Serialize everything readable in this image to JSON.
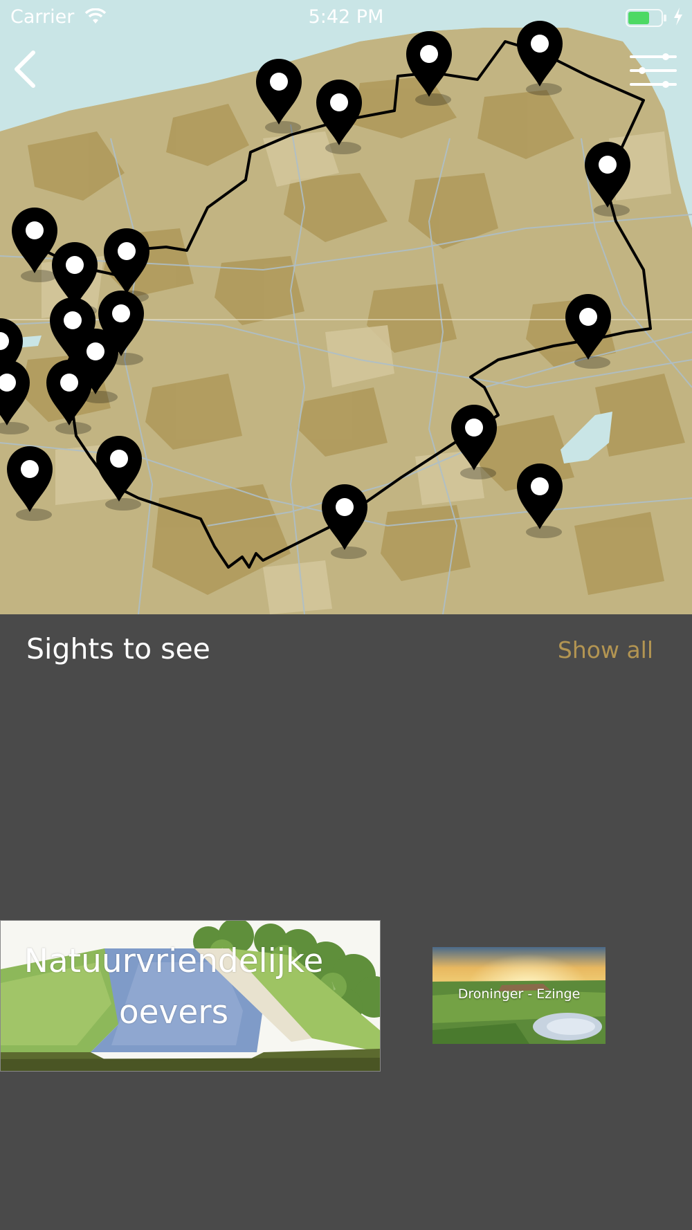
{
  "status_bar": {
    "carrier": "Carrier",
    "time": "5:42 PM",
    "battery_color": "#4cd964"
  },
  "navigation": {
    "back_icon": "chevron-left-icon",
    "filter_icon": "sliders-icon"
  },
  "map": {
    "route_color": "#000000",
    "marker_icon": "map-pin-icon",
    "land_color": "#c6b98a",
    "water_color": "#c9e5e6"
  },
  "sights": {
    "title": "Sights to see",
    "show_all": "Show all",
    "accent_color": "#b39552",
    "cards": [
      {
        "title_line1": "Natuurvriendelijke",
        "title_line2": "oevers"
      },
      {
        "title": "Droninger - Ezinge"
      }
    ]
  }
}
